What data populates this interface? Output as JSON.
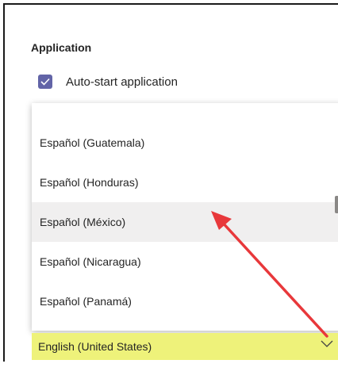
{
  "application": {
    "section_title": "Application",
    "auto_start": {
      "label": "Auto-start application",
      "checked": true
    }
  },
  "language_dropdown": {
    "options": [
      {
        "label": "Español (Guatemala)",
        "hovered": false
      },
      {
        "label": "Español (Honduras)",
        "hovered": false
      },
      {
        "label": "Español (México)",
        "hovered": true
      },
      {
        "label": "Español (Nicaragua)",
        "hovered": false
      },
      {
        "label": "Español (Panamá)",
        "hovered": false
      }
    ],
    "selected_value": "English (United States)"
  },
  "colors": {
    "checkbox_accent": "#6264a7",
    "hover_background": "#f0efef",
    "select_highlight": "#eef27a",
    "annotation_arrow": "#e8383b"
  },
  "icons": {
    "checkbox": "checkmark-icon",
    "dropdown": "chevron-down-icon",
    "annotation": "red-arrow-icon"
  }
}
